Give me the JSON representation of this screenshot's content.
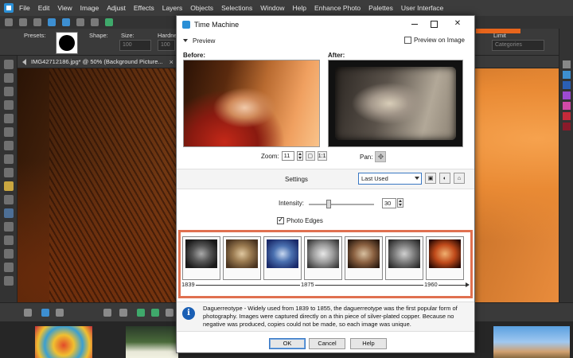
{
  "menubar": {
    "items": [
      "File",
      "Edit",
      "View",
      "Image",
      "Adjust",
      "Effects",
      "Layers",
      "Objects",
      "Selections",
      "Window",
      "Help",
      "Enhance Photo",
      "Palettes",
      "User Interface"
    ]
  },
  "options": {
    "presets_label": "Presets:",
    "shape_label": "Shape:",
    "size_label": "Size:",
    "size_value": "100",
    "hardness_label": "Hardnes",
    "hardness_value": "100",
    "limit_label": "Limit",
    "limit_value": "Categories"
  },
  "document": {
    "tab_title": "IMG42712186.jpg* @  50% (Background Picture..."
  },
  "dialog": {
    "title": "Time Machine",
    "preview_label": "Preview",
    "preview_on_image_label": "Preview on Image",
    "preview_on_image_checked": false,
    "before_label": "Before:",
    "after_label": "After:",
    "zoom_label": "Zoom:",
    "zoom_value": "11",
    "pan_label": "Pan:",
    "settings_label": "Settings",
    "settings_value": "Last Used",
    "intensity_label": "Intensity:",
    "intensity_value": "30",
    "intensity_fraction": 0.3,
    "photo_edges_label": "Photo Edges",
    "photo_edges_checked": true,
    "timeline": {
      "start": "1839",
      "mid": "1875",
      "end": "1960"
    },
    "description": "Daguerreotype - Widely used from 1839 to 1855, the daguerreotype was the first popular form of photography. Images were captured directly on a thin piece of silver-plated copper. Because no negative was produced, copies could not be made, so each image was unique.",
    "buttons": {
      "ok": "OK",
      "cancel": "Cancel",
      "help": "Help"
    }
  },
  "colors": {
    "accent_orange": "#e8651c",
    "selection_border": "#e07050",
    "info_blue": "#1a5fb4"
  }
}
